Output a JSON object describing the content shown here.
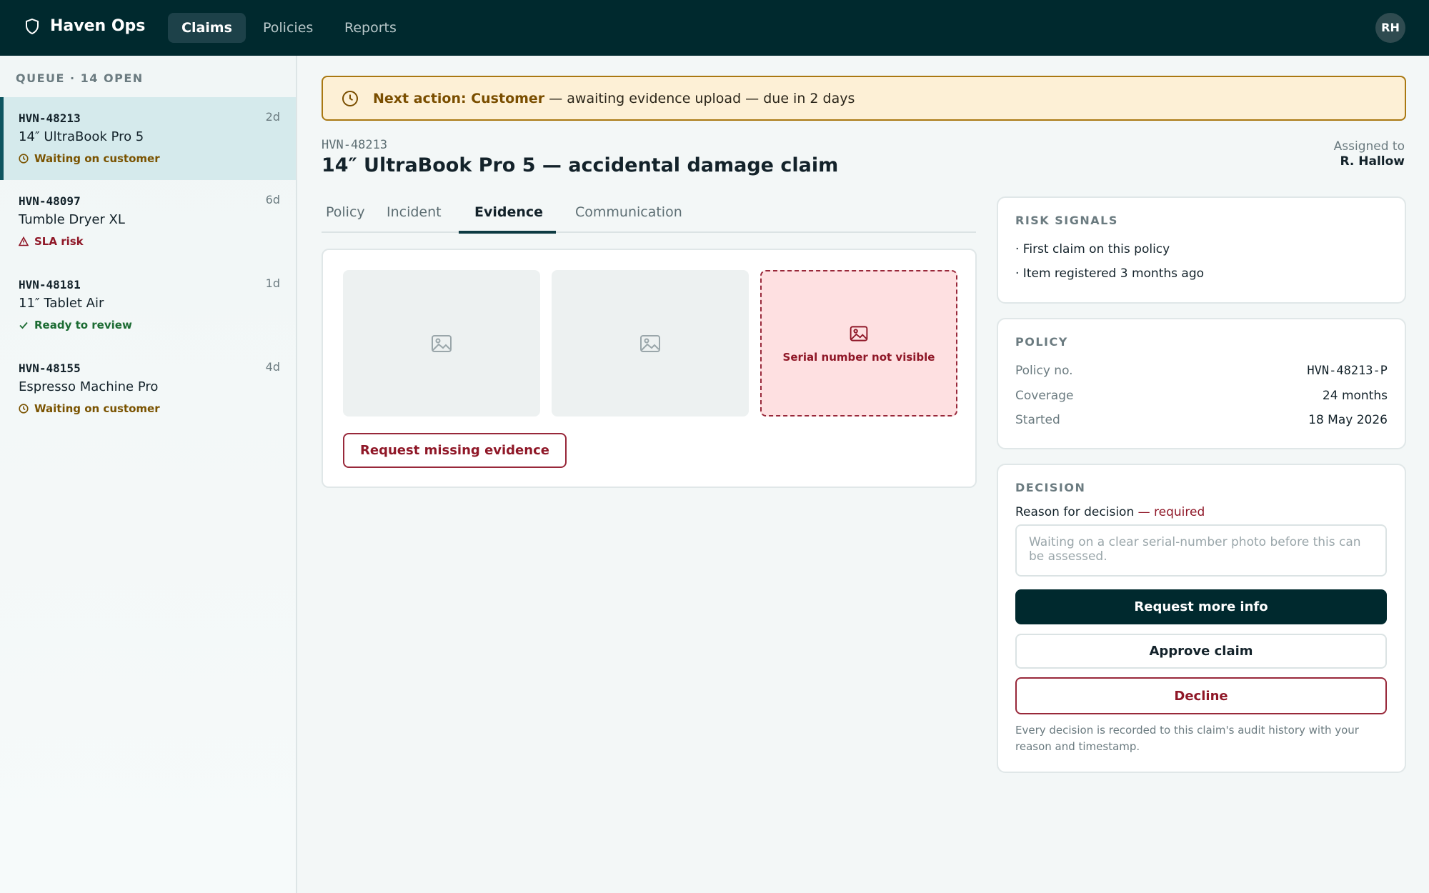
{
  "app": {
    "brand": "Haven Ops",
    "avatar_initials": "RH"
  },
  "nav": {
    "tabs": [
      "Claims",
      "Policies",
      "Reports"
    ],
    "active": "Claims"
  },
  "queue": {
    "title": "QUEUE · 14 OPEN",
    "items": [
      {
        "id": "HVN-48213",
        "age": "2d",
        "name": "14″ UltraBook Pro 5",
        "status": "Waiting on customer",
        "status_type": "waiting",
        "selected": true
      },
      {
        "id": "HVN-48097",
        "age": "6d",
        "name": "Tumble Dryer XL",
        "status": "SLA risk",
        "status_type": "risk",
        "selected": false
      },
      {
        "id": "HVN-48181",
        "age": "1d",
        "name": "11″ Tablet Air",
        "status": "Ready to review",
        "status_type": "ready",
        "selected": false
      },
      {
        "id": "HVN-48155",
        "age": "4d",
        "name": "Espresso Machine Pro",
        "status": "Waiting on customer",
        "status_type": "waiting",
        "selected": false
      }
    ]
  },
  "banner": {
    "strong": "Next action: Customer",
    "text": " — awaiting evidence upload — due in 2 days"
  },
  "claim": {
    "id": "HVN-48213",
    "title": "14″ UltraBook Pro 5 — accidental damage claim",
    "assigned_label": "Assigned to",
    "assigned_name": "R. Hallow"
  },
  "tabs": {
    "items": [
      "Policy",
      "Incident",
      "Evidence",
      "Communication"
    ],
    "active": "Evidence"
  },
  "evidence": {
    "flagged_text": "Serial number not visible",
    "request_button": "Request missing evidence"
  },
  "risk": {
    "title": "RISK SIGNALS",
    "signals": [
      "· First claim on this policy",
      "· Item registered 3 months ago"
    ]
  },
  "policy": {
    "title": "POLICY",
    "rows": [
      {
        "label": "Policy no.",
        "value": "HVN-48213-P"
      },
      {
        "label": "Coverage",
        "value": "24 months"
      },
      {
        "label": "Started",
        "value": "18 May 2026"
      }
    ]
  },
  "decision": {
    "title": "DECISION",
    "reason_label": "Reason for decision",
    "required": " — required",
    "placeholder": "Waiting on a clear serial-number photo before this can be assessed.",
    "request_info": "Request more info",
    "approve": "Approve claim",
    "decline": "Decline",
    "audit_note": "Every decision is recorded to this claim's audit history with your reason and timestamp."
  },
  "colors": {
    "nav_bg": "#00292e",
    "banner_bg": "#fdf0d6",
    "danger": "#8f1727",
    "waiting": "#7a5300",
    "ready": "#1b6b32"
  }
}
